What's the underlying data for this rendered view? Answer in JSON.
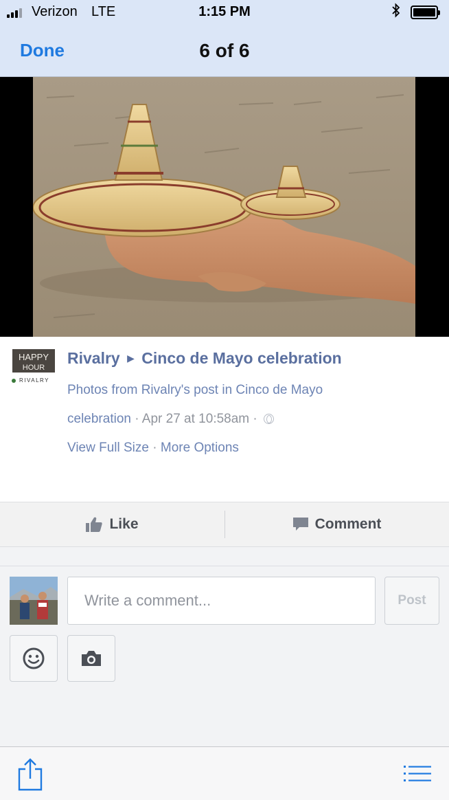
{
  "status_bar": {
    "carrier": "Verizon",
    "network": "LTE",
    "time": "1:15 PM"
  },
  "nav": {
    "done_label": "Done",
    "counter": "6 of 6"
  },
  "post": {
    "page_name": "Rivalry",
    "event_name": "Cinco de Mayo celebration",
    "description_line1": "Photos from Rivalry's post in Cinco de Mayo",
    "description_line2_link": "celebration",
    "separator": "·",
    "date": "Apr 27 at 10:58am",
    "view_full_size": "View Full Size",
    "more_options": "More Options",
    "page_logo": {
      "line1": "HAPPY",
      "line2": "HOUR",
      "line3": "RIVALRY"
    }
  },
  "actions": {
    "like_label": "Like",
    "comment_label": "Comment"
  },
  "composer": {
    "placeholder": "Write a comment...",
    "post_label": "Post"
  },
  "icons": {
    "like": "thumbs-up-icon",
    "comment": "speech-bubble-icon",
    "emoji": "smiley-icon",
    "camera": "camera-icon",
    "share": "share-icon",
    "list": "list-icon",
    "privacy": "globe-icon"
  },
  "colors": {
    "header_bg": "#dbe6f7",
    "link_blue": "#1f7ae0",
    "fb_link": "#5a6f9f"
  }
}
